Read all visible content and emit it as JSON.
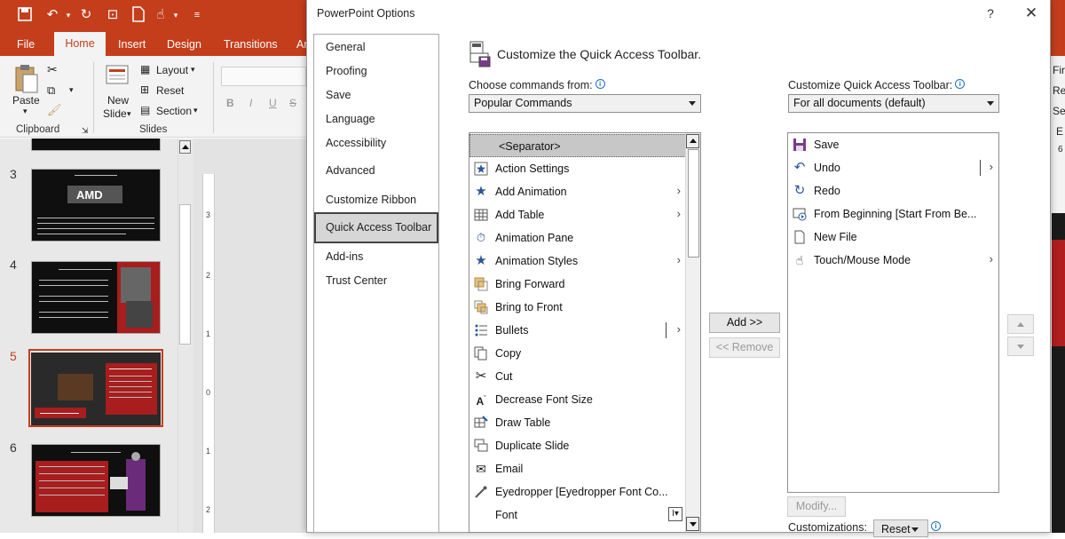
{
  "ppt": {
    "tabs": [
      "File",
      "Home",
      "Insert",
      "Design",
      "Transitions",
      "An"
    ],
    "active_tab": "Home",
    "ribbon": {
      "paste": "Paste",
      "new_slide_line1": "New",
      "new_slide_line2": "Slide",
      "layout": "Layout",
      "reset": "Reset",
      "section": "Section",
      "clipboard_group": "Clipboard",
      "slides_group": "Slides",
      "bold": "B",
      "italic": "I",
      "underline": "U",
      "strike": "S"
    },
    "slide_numbers": [
      "3",
      "4",
      "5",
      "6"
    ],
    "active_slide": "5",
    "ruler_numbers": [
      "3",
      "2",
      "1",
      "0",
      "1",
      "2"
    ],
    "right_edge": [
      "Fir",
      "Re",
      "Sel",
      "E",
      "6"
    ],
    "accent_color": "#c43e1c"
  },
  "dialog": {
    "title": "PowerPoint Options",
    "help": "?",
    "close": "✕",
    "nav": [
      "General",
      "Proofing",
      "Save",
      "Language",
      "Accessibility",
      "Advanced",
      "Customize Ribbon",
      "Quick Access Toolbar",
      "Add-ins",
      "Trust Center"
    ],
    "selected_nav": "Quick Access Toolbar",
    "header": "Customize the Quick Access Toolbar.",
    "choose_label": "Choose commands from:",
    "choose_value": "Popular Commands",
    "customize_label": "Customize Quick Access Toolbar:",
    "customize_value": "For all documents (default)",
    "commands": [
      {
        "label": "<Separator>",
        "icon": "separator",
        "arrow": "",
        "selected": true
      },
      {
        "label": "Action Settings",
        "icon": "action-settings-icon",
        "arrow": ""
      },
      {
        "label": "Add Animation",
        "icon": "add-animation-icon",
        "arrow": "›"
      },
      {
        "label": "Add Table",
        "icon": "table-icon",
        "arrow": "›"
      },
      {
        "label": "Animation Pane",
        "icon": "animation-pane-icon",
        "arrow": ""
      },
      {
        "label": "Animation Styles",
        "icon": "animation-styles-icon",
        "arrow": "›"
      },
      {
        "label": "Bring Forward",
        "icon": "bring-forward-icon",
        "arrow": ""
      },
      {
        "label": "Bring to Front",
        "icon": "bring-to-front-icon",
        "arrow": ""
      },
      {
        "label": "Bullets",
        "icon": "bullets-icon",
        "arrow": "›"
      },
      {
        "label": "Copy",
        "icon": "copy-icon",
        "arrow": ""
      },
      {
        "label": "Cut",
        "icon": "cut-icon",
        "arrow": ""
      },
      {
        "label": "Decrease Font Size",
        "icon": "decrease-font-icon",
        "arrow": ""
      },
      {
        "label": "Draw Table",
        "icon": "draw-table-icon",
        "arrow": ""
      },
      {
        "label": "Duplicate Slide",
        "icon": "duplicate-slide-icon",
        "arrow": ""
      },
      {
        "label": "Email",
        "icon": "email-icon",
        "arrow": ""
      },
      {
        "label": "Eyedropper [Eyedropper Font Co...",
        "icon": "eyedropper-icon",
        "arrow": ""
      },
      {
        "label": "Font",
        "icon": "font-icon",
        "arrow": ""
      }
    ],
    "add_button": "Add >>",
    "remove_button": "<< Remove",
    "qat_items": [
      {
        "label": "Save",
        "icon": "save-icon",
        "arrow": ""
      },
      {
        "label": "Undo",
        "icon": "undo-icon",
        "arrow": "›"
      },
      {
        "label": "Redo",
        "icon": "redo-icon",
        "arrow": ""
      },
      {
        "label": "From Beginning [Start From Be...",
        "icon": "from-beginning-icon",
        "arrow": ""
      },
      {
        "label": "New File",
        "icon": "new-file-icon",
        "arrow": ""
      },
      {
        "label": "Touch/Mouse Mode",
        "icon": "touch-mode-icon",
        "arrow": "›"
      }
    ],
    "modify_button": "Modify...",
    "customizations_label": "Customizations:",
    "reset_button": "Reset"
  }
}
